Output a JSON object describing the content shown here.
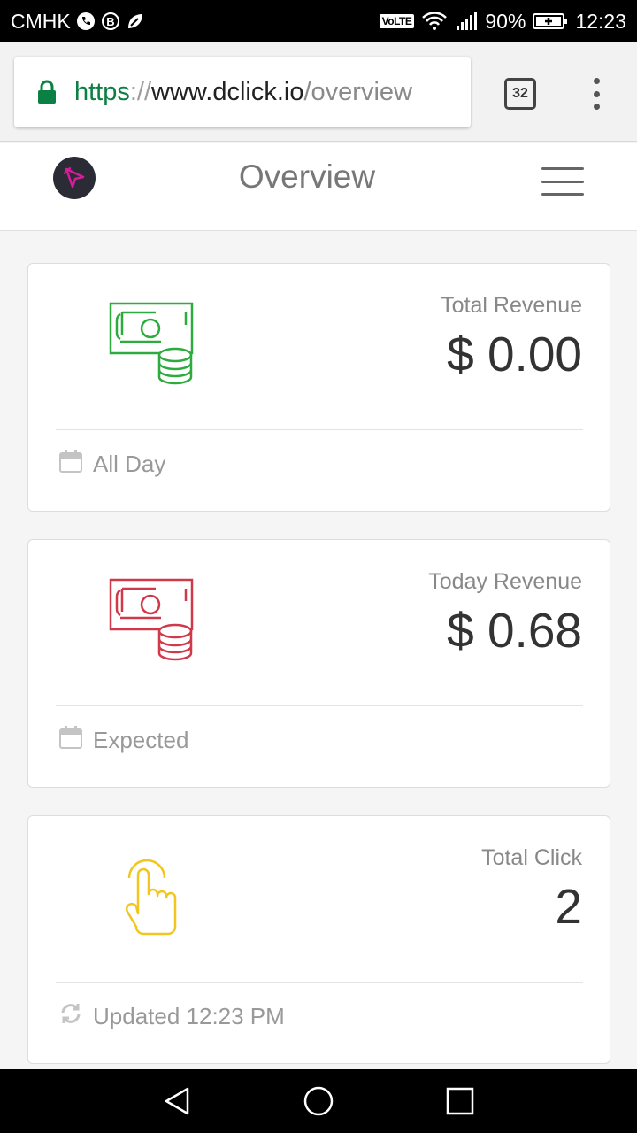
{
  "status_bar": {
    "carrier": "CMHK",
    "volte": "VoLTE",
    "battery": "90%",
    "time": "12:23"
  },
  "browser": {
    "url_scheme": "https",
    "url_sep": "://",
    "url_host": "www.dclick.io",
    "url_path": "/overview",
    "tab_count": "32"
  },
  "header": {
    "title": "Overview"
  },
  "cards": [
    {
      "label": "Total Revenue",
      "value": "$ 0.00",
      "footer": "All Day",
      "icon": "money-icon",
      "icon_color": "#2eab3f",
      "footer_icon": "calendar-icon"
    },
    {
      "label": "Today Revenue",
      "value": "$ 0.68",
      "footer": "Expected",
      "icon": "money-icon",
      "icon_color": "#d0394a",
      "footer_icon": "calendar-icon"
    },
    {
      "label": "Total Click",
      "value": "2",
      "footer": "Updated 12:23 PM",
      "icon": "hand-pointer-icon",
      "icon_color": "#f2c61f",
      "footer_icon": "refresh-icon"
    }
  ]
}
